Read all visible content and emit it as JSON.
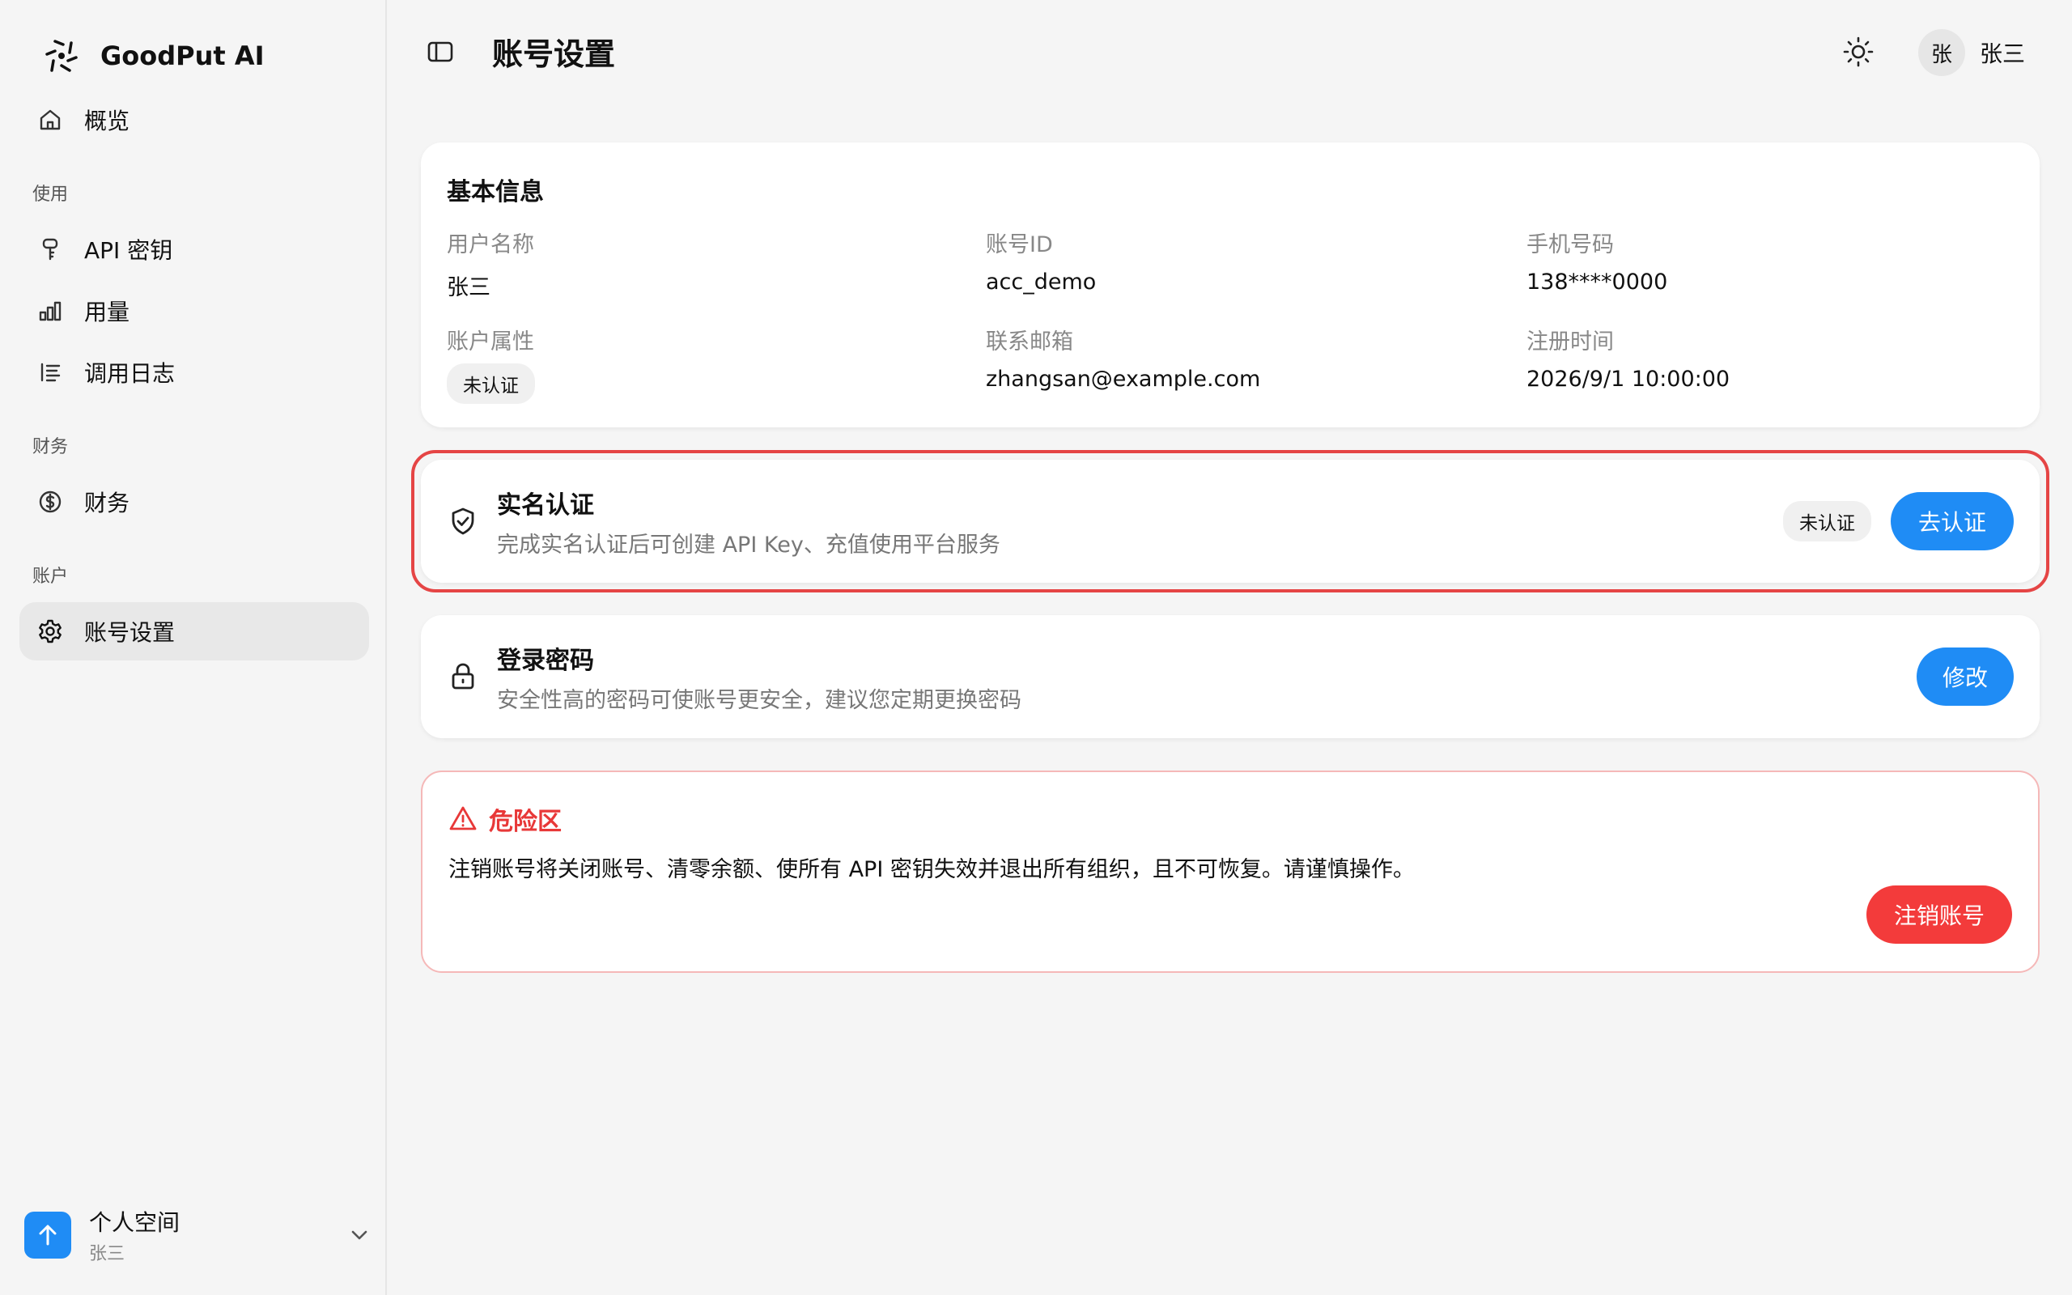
{
  "brand": {
    "name": "GoodPut AI"
  },
  "sidebar": {
    "overview": "概览",
    "sections": {
      "usage": "使用",
      "finance": "财务",
      "account": "账户"
    },
    "items": {
      "api_keys": "API 密钥",
      "usage": "用量",
      "logs": "调用日志",
      "finance": "财务",
      "account_settings": "账号设置"
    },
    "workspace": {
      "title": "个人空间",
      "subtitle": "张三"
    }
  },
  "header": {
    "title": "账号设置",
    "user_avatar": "张",
    "user_name": "张三"
  },
  "basic_info": {
    "title": "基本信息",
    "username_label": "用户名称",
    "username_value": "张三",
    "account_id_label": "账号ID",
    "account_id_value": "acc_demo",
    "phone_label": "手机号码",
    "phone_value": "138****0000",
    "attr_label": "账户属性",
    "attr_value": "未认证",
    "email_label": "联系邮箱",
    "email_value": "zhangsan@example.com",
    "reg_label": "注册时间",
    "reg_value": "2026/9/1 10:00:00"
  },
  "verification": {
    "title": "实名认证",
    "desc": "完成实名认证后可创建 API Key、充值使用平台服务",
    "status": "未认证",
    "button": "去认证"
  },
  "password": {
    "title": "登录密码",
    "desc": "安全性高的密码可使账号更安全，建议您定期更换密码",
    "button": "修改"
  },
  "danger": {
    "title": "危险区",
    "desc": "注销账号将关闭账号、清零余额、使所有 API 密钥失效并退出所有组织，且不可恢复。请谨慎操作。",
    "button": "注销账号"
  },
  "colors": {
    "primary": "#1f8cf5",
    "danger": "#f33b3b",
    "highlight": "#e54545"
  }
}
